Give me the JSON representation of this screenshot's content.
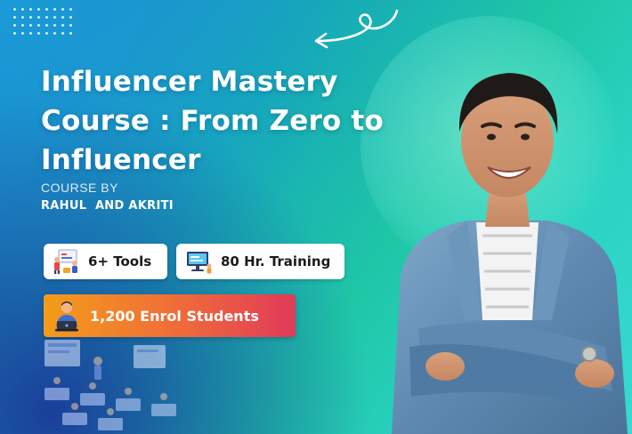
{
  "course": {
    "title_line1": "Influencer Mastery",
    "title_line2": "Course : From Zero to",
    "title_line3": "Influencer",
    "byline_label": "COURSE BY",
    "authors": "RAHUL  AND AKRITI"
  },
  "features": {
    "tools": {
      "label": "6+ Tools",
      "icon": "team-tools-icon"
    },
    "training": {
      "label": "80 Hr. Training",
      "icon": "computer-training-icon"
    },
    "enrolment": {
      "label": "1,200 Enrol Students",
      "icon": "student-laptop-icon"
    }
  },
  "decor": {
    "dots_icon": "dot-grid-pattern",
    "arrow_icon": "curly-arrow-icon",
    "classroom_icon": "classroom-illustration",
    "presenter_icon": "instructor-photo"
  },
  "colors": {
    "accent_start": "#f39c1a",
    "accent_end": "#e03a5a",
    "background_teal": "#1fc6a6",
    "background_blue": "#1e7fd0"
  }
}
